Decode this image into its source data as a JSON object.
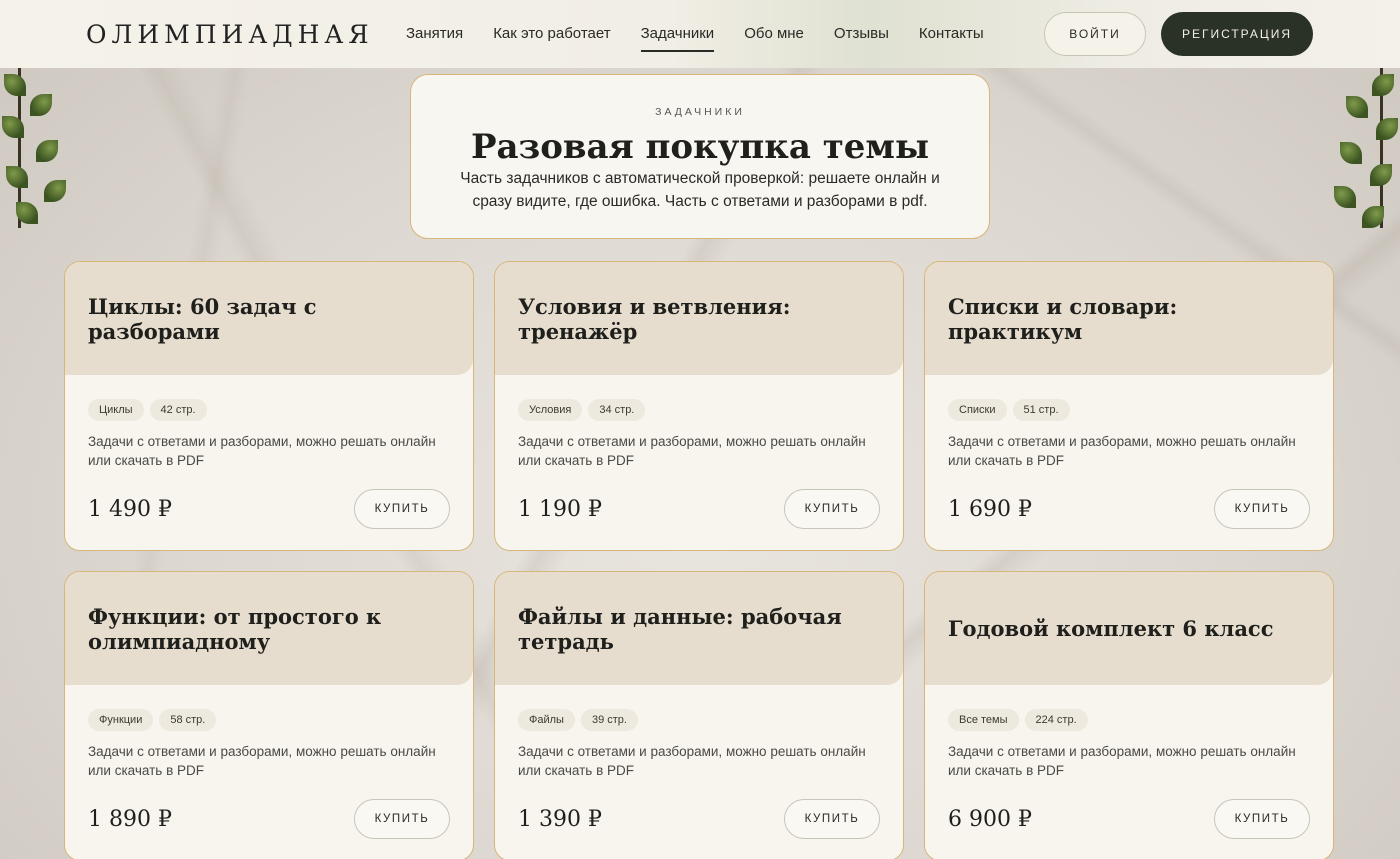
{
  "header": {
    "logo": "ОЛИМПИАДНАЯ",
    "nav": [
      {
        "label": "Занятия"
      },
      {
        "label": "Как это работает"
      },
      {
        "label": "Задачники",
        "active": true
      },
      {
        "label": "Обо мне"
      },
      {
        "label": "Отзывы"
      },
      {
        "label": "Контакты"
      }
    ],
    "login_label": "ВОЙТИ",
    "register_label": "РЕГИСТРАЦИЯ"
  },
  "hero": {
    "eyebrow": "ЗАДАЧНИКИ",
    "title": "Разовая покупка темы",
    "description": "Часть задачников с автоматической проверкой: решаете онлайн и сразу видите, где ошибка. Часть с ответами и разборами в pdf."
  },
  "cards": [
    {
      "title": "Циклы: 60 задач с разборами",
      "tag": "Циклы",
      "pages": "42 стр.",
      "description": "Задачи с ответами и разборами, можно решать онлайн или скачать в PDF",
      "price": "1 490 ₽",
      "buy_label": "КУПИТЬ"
    },
    {
      "title": "Условия и ветвления: тренажёр",
      "tag": "Условия",
      "pages": "34 стр.",
      "description": "Задачи с ответами и разборами, можно решать онлайн или скачать в PDF",
      "price": "1 190 ₽",
      "buy_label": "КУПИТЬ"
    },
    {
      "title": "Списки и словари: практикум",
      "tag": "Списки",
      "pages": "51 стр.",
      "description": "Задачи с ответами и разборами, можно решать онлайн или скачать в PDF",
      "price": "1 690 ₽",
      "buy_label": "КУПИТЬ"
    },
    {
      "title": "Функции: от простого к олимпиадному",
      "tag": "Функции",
      "pages": "58 стр.",
      "description": "Задачи с ответами и разборами, можно решать онлайн или скачать в PDF",
      "price": "1 890 ₽",
      "buy_label": "КУПИТЬ"
    },
    {
      "title": "Файлы и данные: рабочая тетрадь",
      "tag": "Файлы",
      "pages": "39 стр.",
      "description": "Задачи с ответами и разборами, можно решать онлайн или скачать в PDF",
      "price": "1 390 ₽",
      "buy_label": "КУПИТЬ"
    },
    {
      "title": "Годовой комплект 6 класс",
      "tag": "Все темы",
      "pages": "224 стр.",
      "description": "Задачи с ответами и разборами, можно решать онлайн или скачать в PDF",
      "price": "6 900 ₽",
      "buy_label": "КУПИТЬ"
    }
  ],
  "colors": {
    "accent_dark": "#2a3226",
    "card_border": "#d8b67a",
    "card_head": "#e6ddcf"
  }
}
